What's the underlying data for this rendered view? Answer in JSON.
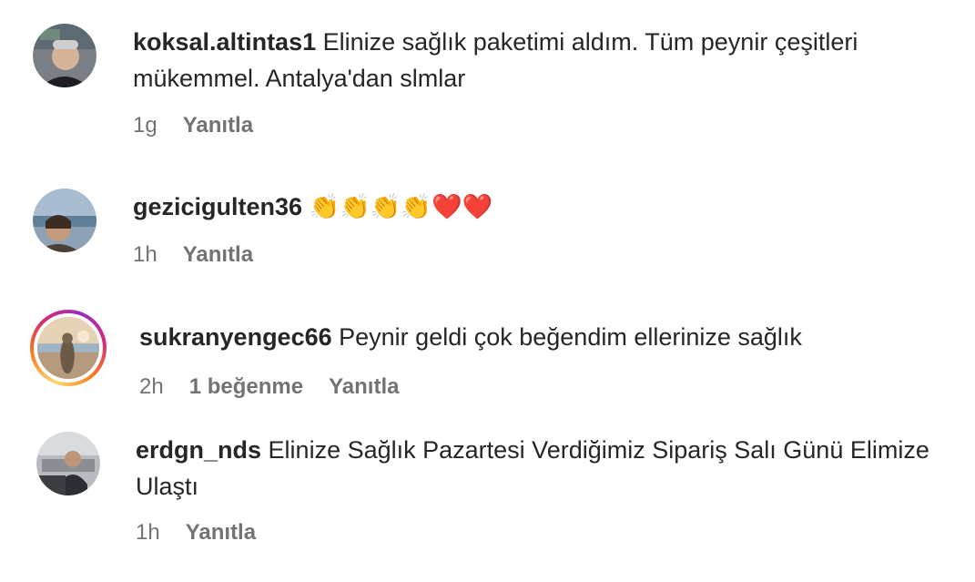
{
  "comments": [
    {
      "username": "koksal.altintas1",
      "text": "Elinize sağlık paketimi aldım. Tüm peynir çeşitleri mükemmel. Antalya'dan slmlar",
      "time": "1g",
      "reply_label": "Yanıtla",
      "likes_label": null,
      "has_story": false
    },
    {
      "username": "gezicigulten36",
      "text": "👏👏👏👏❤️❤️",
      "time": "1h",
      "reply_label": "Yanıtla",
      "likes_label": null,
      "has_story": false
    },
    {
      "username": "sukranyengec66",
      "text": "Peynir geldi çok beğendim ellerinize sağlık",
      "time": "2h",
      "likes_label": "1 beğenme",
      "reply_label": "Yanıtla",
      "has_story": true
    },
    {
      "username": "erdgn_nds",
      "text": "Elinize Sağlık Pazartesi Verdiğimiz Sipariş Salı Günü Elimize Ulaştı",
      "time": "1h",
      "reply_label": "Yanıtla",
      "likes_label": null,
      "has_story": false
    }
  ],
  "colors": {
    "text": "#262626",
    "secondary": "#737373",
    "story_ring": "#d62976"
  }
}
